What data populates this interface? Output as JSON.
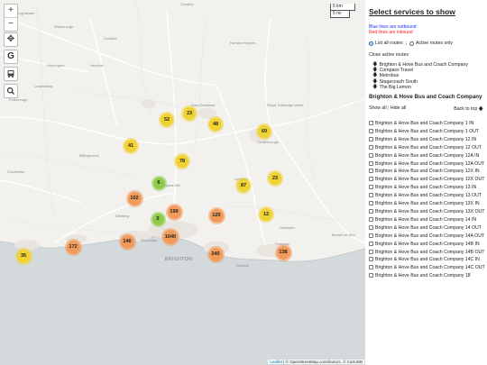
{
  "map": {
    "zoom_in": "+",
    "zoom_out": "−",
    "scale_km": "5 km",
    "scale_mi": "5 mi",
    "attribution_leaflet": "Leaflet",
    "attribution_osm": "© OpenStreetMap contributors, © CartoDB",
    "brighton_label": "BRIGHTON",
    "clusters": [
      {
        "count": "52",
        "color": "#f0d232"
      },
      {
        "count": "23",
        "color": "#f0d232"
      },
      {
        "count": "48",
        "color": "#f0d232"
      },
      {
        "count": "69",
        "color": "#f0d232"
      },
      {
        "count": "41",
        "color": "#f0d232"
      },
      {
        "count": "78",
        "color": "#f0d232"
      },
      {
        "count": "6",
        "color": "#8dcc4a"
      },
      {
        "count": "87",
        "color": "#f0d232"
      },
      {
        "count": "23",
        "color": "#f0d232"
      },
      {
        "count": "102",
        "color": "#f29a5a"
      },
      {
        "count": "199",
        "color": "#f29a5a"
      },
      {
        "count": "5",
        "color": "#8dcc4a"
      },
      {
        "count": "125",
        "color": "#f29a5a"
      },
      {
        "count": "12",
        "color": "#f0d232"
      },
      {
        "count": "1040",
        "color": "#f29a5a"
      },
      {
        "count": "146",
        "color": "#f29a5a"
      },
      {
        "count": "172",
        "color": "#f29a5a"
      },
      {
        "count": "35",
        "color": "#f0d232"
      },
      {
        "count": "240",
        "color": "#f29a5a"
      },
      {
        "count": "138",
        "color": "#f29a5a"
      }
    ]
  },
  "panel": {
    "title": "Select services to show",
    "blue_note": "Blue lines are outbound",
    "red_note": "Red lines are inbound",
    "list_all": "List all routes",
    "active_only": "Active routes only",
    "close_active": "Close active routes",
    "operators": [
      "Brighton & Hove Bus and Coach Company",
      "Compass Travel",
      "Metrobus",
      "Stagecoach South",
      "The Big Lemon"
    ],
    "section_title": "Brighton & Hove Bus and Coach Company",
    "show_all": "Show all",
    "hide_all": "Hide all",
    "back_to_top": "Back to top",
    "routes": [
      "Brighton & Hove Bus and Coach Company 1 IN",
      "Brighton & Hove Bus and Coach Company 1 OUT",
      "Brighton & Hove Bus and Coach Company 12 IN",
      "Brighton & Hove Bus and Coach Company 12 OUT",
      "Brighton & Hove Bus and Coach Company 12A IN",
      "Brighton & Hove Bus and Coach Company 12A OUT",
      "Brighton & Hove Bus and Coach Company 12X IN",
      "Brighton & Hove Bus and Coach Company 12X OUT",
      "Brighton & Hove Bus and Coach Company 13 IN",
      "Brighton & Hove Bus and Coach Company 13 OUT",
      "Brighton & Hove Bus and Coach Company 13X IN",
      "Brighton & Hove Bus and Coach Company 13X OUT",
      "Brighton & Hove Bus and Coach Company 14 IN",
      "Brighton & Hove Bus and Coach Company 14 OUT",
      "Brighton & Hove Bus and Coach Company 14A OUT",
      "Brighton & Hove Bus and Coach Company 14B IN",
      "Brighton & Hove Bus and Coach Company 14B OUT",
      "Brighton & Hove Bus and Coach Company 14C IN",
      "Brighton & Hove Bus and Coach Company 14C OUT",
      "Brighton & Hove Bus and Coach Company 18"
    ]
  }
}
